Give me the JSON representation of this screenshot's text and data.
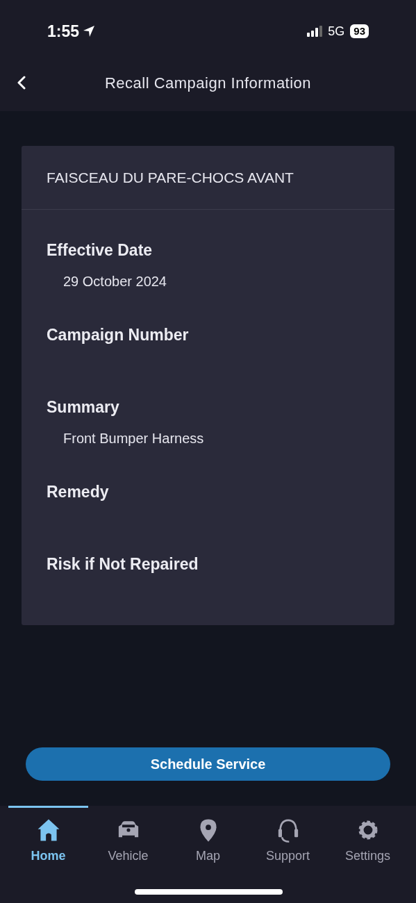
{
  "status_bar": {
    "time": "1:55",
    "network": "5G",
    "battery": "93"
  },
  "header": {
    "title": "Recall Campaign Information"
  },
  "card": {
    "title": "FAISCEAU DU PARE-CHOCS AVANT",
    "fields": [
      {
        "label": "Effective Date",
        "value": "29 October 2024"
      },
      {
        "label": "Campaign Number"
      },
      {
        "label": "Summary",
        "value": "Front Bumper Harness"
      },
      {
        "label": "Remedy"
      },
      {
        "label": "Risk if Not Repaired"
      }
    ]
  },
  "button": "Schedule Service",
  "tabs": [
    {
      "label": "Home",
      "kind": "home",
      "selected": true
    },
    {
      "label": "Vehicle",
      "kind": "car",
      "selected": false
    },
    {
      "label": "Map",
      "kind": "pin",
      "selected": false
    },
    {
      "label": "Support",
      "kind": "headset",
      "selected": false
    },
    {
      "label": "Settings",
      "kind": "gear",
      "selected": false
    }
  ]
}
